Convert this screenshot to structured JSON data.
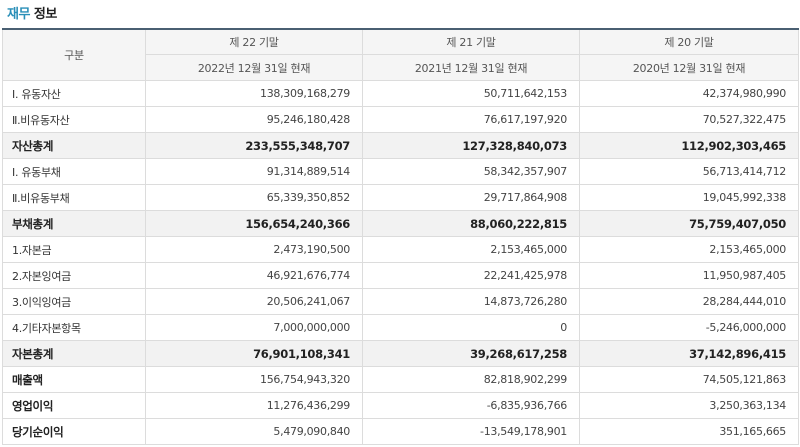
{
  "section_title": {
    "accent": "재무",
    "rest": "정보"
  },
  "header": {
    "category": "구분",
    "periods": [
      "제 22 기말",
      "제 21 기말",
      "제 20 기말"
    ],
    "dates": [
      "2022년 12월 31일 현재",
      "2021년 12월 31일 현재",
      "2020년 12월 31일 현재"
    ]
  },
  "rows": [
    {
      "label": "Ⅰ. 유동자산",
      "values": [
        "138,309,168,279",
        "50,711,642,153",
        "42,374,980,990"
      ],
      "style": "normal"
    },
    {
      "label": "Ⅱ.비유동자산",
      "values": [
        "95,246,180,428",
        "76,617,197,920",
        "70,527,322,475"
      ],
      "style": "normal"
    },
    {
      "label": "자산총계",
      "values": [
        "233,555,348,707",
        "127,328,840,073",
        "112,902,303,465"
      ],
      "style": "total"
    },
    {
      "label": "Ⅰ. 유동부채",
      "values": [
        "91,314,889,514",
        "58,342,357,907",
        "56,713,414,712"
      ],
      "style": "normal"
    },
    {
      "label": "Ⅱ.비유동부채",
      "values": [
        "65,339,350,852",
        "29,717,864,908",
        "19,045,992,338"
      ],
      "style": "normal"
    },
    {
      "label": "부채총계",
      "values": [
        "156,654,240,366",
        "88,060,222,815",
        "75,759,407,050"
      ],
      "style": "total"
    },
    {
      "label": "1.자본금",
      "values": [
        "2,473,190,500",
        "2,153,465,000",
        "2,153,465,000"
      ],
      "style": "normal"
    },
    {
      "label": "2.자본잉여금",
      "values": [
        "46,921,676,774",
        "22,241,425,978",
        "11,950,987,405"
      ],
      "style": "normal"
    },
    {
      "label": "3.이익잉여금",
      "values": [
        "20,506,241,067",
        "14,873,726,280",
        "28,284,444,010"
      ],
      "style": "normal"
    },
    {
      "label": "4.기타자본항목",
      "values": [
        "7,000,000,000",
        "0",
        "-5,246,000,000"
      ],
      "style": "normal"
    },
    {
      "label": "자본총계",
      "values": [
        "76,901,108,341",
        "39,268,617,258",
        "37,142,896,415"
      ],
      "style": "total"
    },
    {
      "label": "매출액",
      "values": [
        "156,754,943,320",
        "82,818,902,299",
        "74,505,121,863"
      ],
      "style": "bold"
    },
    {
      "label": "영업이익",
      "values": [
        "11,276,436,299",
        "-6,835,936,766",
        "3,250,363,134"
      ],
      "style": "bold"
    },
    {
      "label": "당기순이익",
      "values": [
        "5,479,090,840",
        "-13,549,178,901",
        "351,165,665"
      ],
      "style": "bold"
    }
  ]
}
